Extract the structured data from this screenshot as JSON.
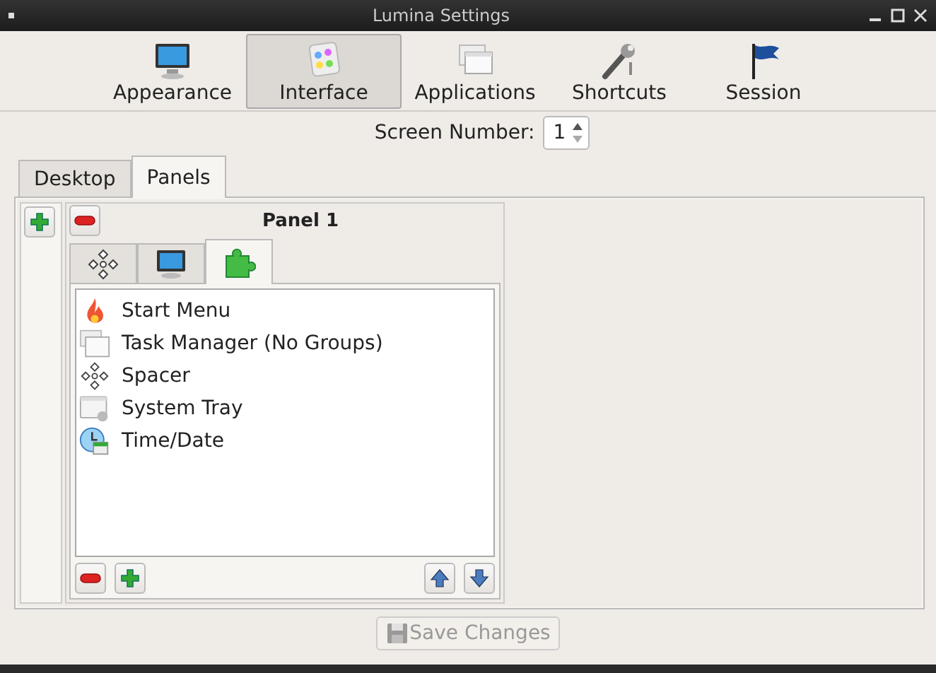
{
  "window": {
    "title": "Lumina Settings"
  },
  "categories": [
    {
      "label": "Appearance",
      "kind": "monitor",
      "selected": false
    },
    {
      "label": "Interface",
      "kind": "palette",
      "selected": true
    },
    {
      "label": "Applications",
      "kind": "windows",
      "selected": false
    },
    {
      "label": "Shortcuts",
      "kind": "wrench",
      "selected": false
    },
    {
      "label": "Session",
      "kind": "flag",
      "selected": false
    }
  ],
  "screen_number": {
    "label": "Screen Number:",
    "value": "1"
  },
  "tabs": [
    {
      "label": "Desktop",
      "selected": false
    },
    {
      "label": "Panels",
      "selected": true
    }
  ],
  "panel": {
    "title": "Panel 1",
    "subtabs": [
      {
        "kind": "spacer",
        "selected": false
      },
      {
        "kind": "monitor",
        "selected": false
      },
      {
        "kind": "puzzle",
        "selected": true
      }
    ],
    "plugins": [
      {
        "label": "Start Menu",
        "kind": "flame"
      },
      {
        "label": "Task Manager (No Groups)",
        "kind": "windows"
      },
      {
        "label": "Spacer",
        "kind": "spacer"
      },
      {
        "label": "System Tray",
        "kind": "tray"
      },
      {
        "label": "Time/Date",
        "kind": "clock"
      }
    ]
  },
  "save_button": {
    "label": "Save Changes",
    "disabled": true
  }
}
